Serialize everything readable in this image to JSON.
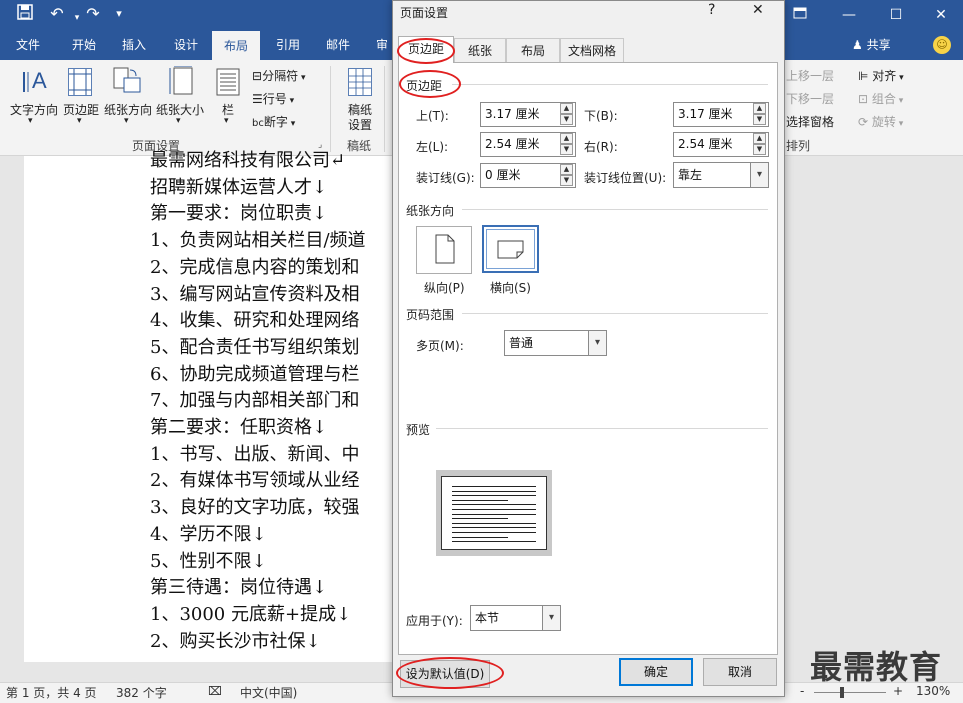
{
  "app": {
    "tabs": [
      "文件",
      "开始",
      "插入",
      "设计",
      "布局",
      "引用",
      "邮件",
      "审"
    ],
    "active_tab": "布局",
    "share": "共享"
  },
  "ribbon": {
    "text_direction": "文字方向",
    "margins": "页边距",
    "orientation": "纸张方向",
    "size": "纸张大小",
    "columns": "栏",
    "breaks": "分隔符",
    "line_numbers": "行号",
    "hyphenation": "断字",
    "page_setup_group": "页面设置",
    "draft_paper_1": "稿纸",
    "draft_paper_2": "设置",
    "draft_group": "稿纸",
    "bring_forward": "上移一层",
    "send_backward": "下移一层",
    "selection_pane": "选择窗格",
    "align": "对齐",
    "group": "组合",
    "rotate": "旋转",
    "arrange_group": "排列"
  },
  "document": {
    "lines": [
      "最需网络科技有限公司↵",
      "招聘新媒体运营人才↓",
      "第一要求：岗位职责↓",
      "1、负责网站相关栏目/频道",
      "2、完成信息内容的策划和",
      "3、编写网站宣传资料及相",
      "4、收集、研究和处理网络",
      "5、配合责任书写组织策划",
      "6、协助完成频道管理与栏",
      "7、加强与内部相关部门和",
      "第二要求：任职资格↓",
      "1、书写、出版、新闻、中",
      "2、有媒体书写领域从业经",
      "3、良好的文字功底，较强",
      "4、学历不限↓",
      "5、性别不限↓",
      "第三待遇：岗位待遇↓",
      "1、3000 元底薪+提成↓",
      "2、购买长沙市社保↓"
    ]
  },
  "status": {
    "page": "第 1 页，共 4 页",
    "words": "382 个字",
    "lang": "中文(中国)",
    "zoom": "130%",
    "minus": "-",
    "plus": "+"
  },
  "dialog": {
    "title": "页面设置",
    "help": "?",
    "close": "✕",
    "tabs": [
      "页边距",
      "纸张",
      "布局",
      "文档网格"
    ],
    "margins_section": "页边距",
    "top_label": "上(T):",
    "top_value": "3.17 厘米",
    "bottom_label": "下(B):",
    "bottom_value": "3.17 厘米",
    "left_label": "左(L):",
    "left_value": "2.54 厘米",
    "right_label": "右(R):",
    "right_value": "2.54 厘米",
    "gutter_label": "装订线(G):",
    "gutter_value": "0 厘米",
    "gutter_pos_label": "装订线位置(U):",
    "gutter_pos_value": "靠左",
    "orientation_section": "纸张方向",
    "portrait": "纵向(P)",
    "landscape": "横向(S)",
    "pages_section": "页码范围",
    "multiple_pages_label": "多页(M):",
    "multiple_pages_value": "普通",
    "preview_section": "预览",
    "apply_to_label": "应用于(Y):",
    "apply_to_value": "本节",
    "set_default": "设为默认值(D)",
    "ok": "确定",
    "cancel": "取消"
  },
  "watermark": "最需教育",
  "colors": {
    "accent": "#2b579a",
    "annotation": "#e02020",
    "focus": "#0078d7"
  }
}
